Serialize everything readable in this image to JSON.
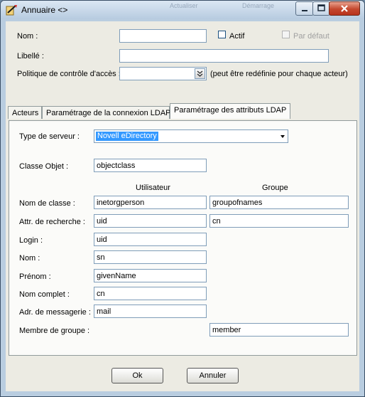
{
  "window": {
    "title": "Annuaire <>",
    "ghost_text_1": "Actualiser",
    "ghost_text_2": "Démarrage"
  },
  "header_form": {
    "nom_label": "Nom :",
    "nom_value": "",
    "actif_label": "Actif",
    "actif_checked": false,
    "par_defaut_label": "Par défaut",
    "par_defaut_checked": false,
    "libelle_label": "Libellé :",
    "libelle_value": "",
    "politique_label": "Politique de contrôle d'accès :",
    "politique_value": "",
    "politique_note": "(peut être redéfinie pour chaque acteur)"
  },
  "tabs": [
    {
      "label": "Acteurs"
    },
    {
      "label": "Paramétrage de la connexion LDAP"
    },
    {
      "label": "Paramétrage des attributs LDAP"
    }
  ],
  "active_tab": 2,
  "ldap_attributes": {
    "server_type_label": "Type de serveur :",
    "server_type_value": "Novell eDirectory",
    "object_class_label": "Classe Objet :",
    "object_class_value": "objectclass",
    "col_user": "Utilisateur",
    "col_group": "Groupe",
    "rows": [
      {
        "label": "Nom de classe :",
        "user": "inetorgperson",
        "group": "groupofnames"
      },
      {
        "label": "Attr. de recherche :",
        "user": "uid",
        "group": "cn"
      },
      {
        "label": "Login :",
        "user": "uid"
      },
      {
        "label": "Nom :",
        "user": "sn"
      },
      {
        "label": "Prénom :",
        "user": "givenName"
      },
      {
        "label": "Nom complet :",
        "user": "cn"
      },
      {
        "label": "Adr. de messagerie :",
        "user": "mail"
      },
      {
        "label": "Membre de groupe :",
        "group": "member"
      }
    ]
  },
  "buttons": {
    "ok": "Ok",
    "cancel": "Annuler"
  },
  "colors": {
    "selection": "#3399ff",
    "close_button": "#c4472d",
    "dialog_face": "#ecebe3"
  }
}
